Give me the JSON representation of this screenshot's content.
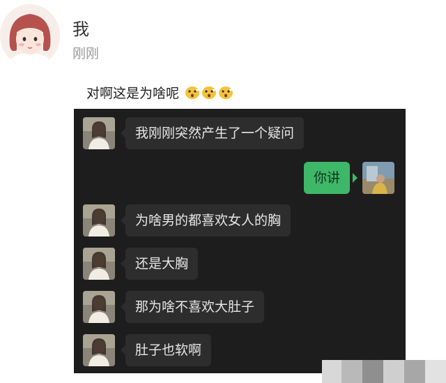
{
  "post": {
    "author": "我",
    "time": "刚刚",
    "text": "对啊这是为啥呢",
    "emojis": [
      "surprised-face-icon",
      "surprised-face-icon",
      "surprised-face-icon"
    ]
  },
  "chat": {
    "theme": "dark",
    "messages": [
      {
        "side": "left",
        "text": "我刚刚突然产生了一个疑问"
      },
      {
        "side": "right",
        "text": "你讲"
      },
      {
        "side": "left",
        "text": "为啥男的都喜欢女人的胸"
      },
      {
        "side": "left",
        "text": "还是大胸"
      },
      {
        "side": "left",
        "text": "那为啥不喜欢大肚子"
      },
      {
        "side": "left",
        "text": "肚子也软啊"
      }
    ]
  },
  "colors": {
    "chat_background": "#1d1d1d",
    "bubble_received": "#2d2d2d",
    "bubble_sent": "#3fb769",
    "author_text": "#333333",
    "time_text": "#9a9a9a"
  }
}
